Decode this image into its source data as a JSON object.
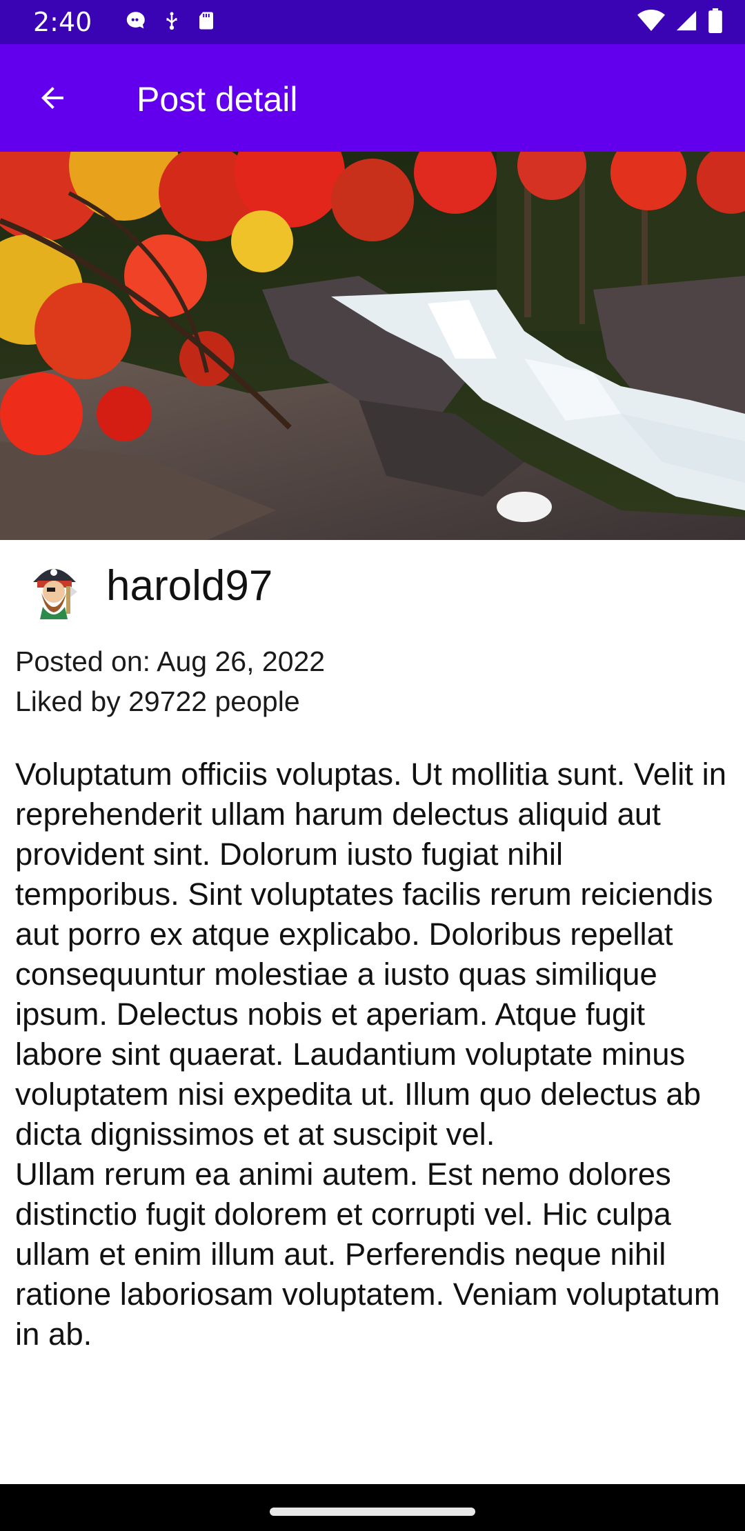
{
  "status_bar": {
    "time": "2:40",
    "background": "#3a03b4",
    "left_icons": [
      "chat-notification-icon",
      "usb-debug-icon",
      "sd-card-icon"
    ],
    "right_icons": [
      "wifi-icon",
      "cellular-signal-icon",
      "battery-icon"
    ]
  },
  "app_bar": {
    "title": "Post detail",
    "background": "#6200ee",
    "back_icon": "arrow-back-icon"
  },
  "post": {
    "image": "autumn-waterfall-photo",
    "author": {
      "username": "harold97",
      "avatar_icon": "pirate-avatar"
    },
    "posted_on": "Posted on: Aug 26, 2022",
    "likes": "Liked by 29722 people",
    "paragraphs": [
      "Voluptatum officiis voluptas. Ut mollitia sunt. Velit in reprehenderit ullam harum delectus aliquid aut provident sint. Dolorum iusto fugiat nihil temporibus. Sint voluptates facilis rerum reiciendis aut porro ex atque explicabo. Doloribus repellat consequuntur molestiae a iusto quas similique ipsum. Delectus nobis et aperiam. Atque fugit labore sint quaerat. Laudantium voluptate minus voluptatem nisi expedita ut. Illum quo delectus ab dicta dignissimos et at suscipit vel.",
      "Ullam rerum ea animi autem. Est nemo dolores distinctio fugit dolorem et corrupti vel. Hic culpa ullam et enim illum aut. Perferendis neque nihil ratione laboriosam voluptatem. Veniam voluptatum in ab."
    ]
  },
  "nav_bar": {
    "background": "#000000",
    "handle_icon": "home-gesture-handle"
  }
}
